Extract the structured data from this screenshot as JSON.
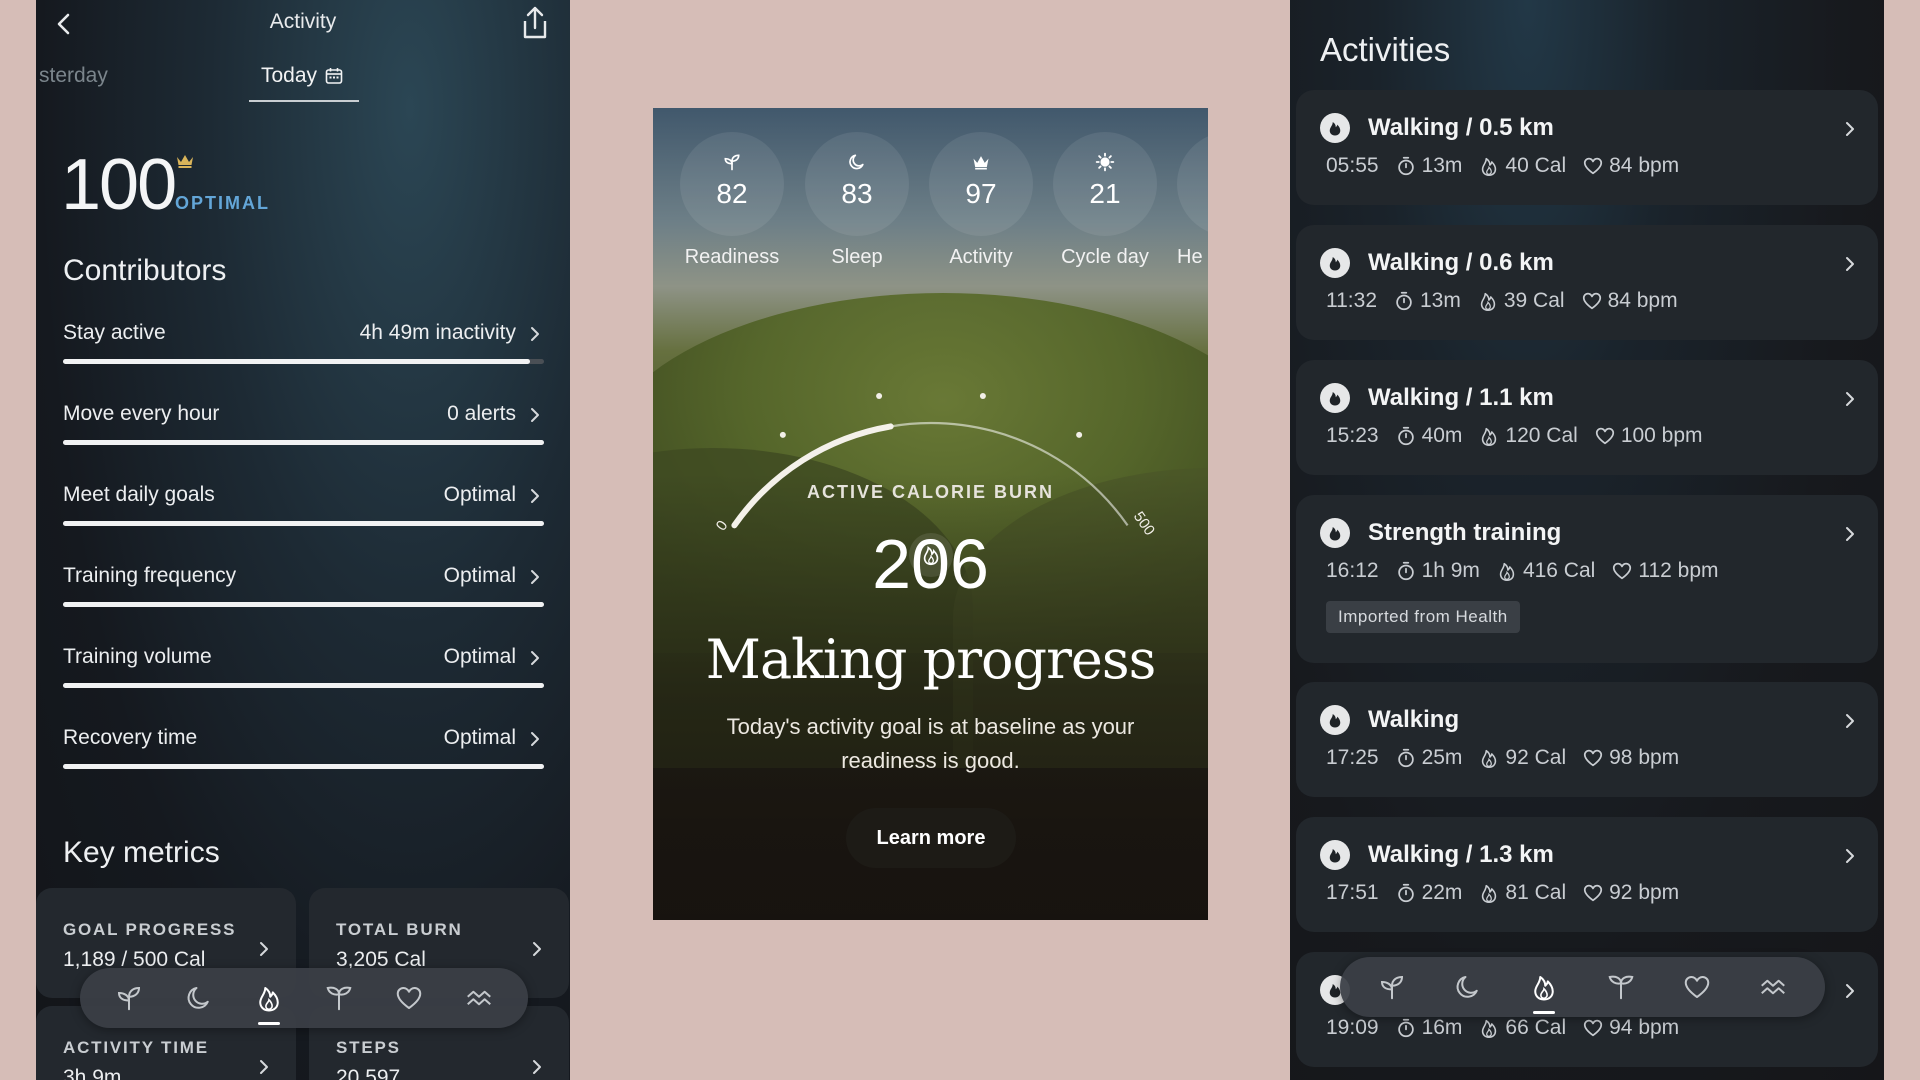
{
  "left": {
    "title": "Activity",
    "day_prev": "sterday",
    "day_current": "Today",
    "score": "100",
    "score_status": "OPTIMAL",
    "contributors_heading": "Contributors",
    "contributors": [
      {
        "label": "Stay active",
        "value": "4h 49m inactivity",
        "level": 0.97
      },
      {
        "label": "Move every hour",
        "value": "0 alerts",
        "level": 1.0
      },
      {
        "label": "Meet daily goals",
        "value": "Optimal",
        "level": 1.0
      },
      {
        "label": "Training frequency",
        "value": "Optimal",
        "level": 1.0
      },
      {
        "label": "Training volume",
        "value": "Optimal",
        "level": 1.0
      },
      {
        "label": "Recovery time",
        "value": "Optimal",
        "level": 1.0
      }
    ],
    "key_metrics_heading": "Key metrics",
    "metrics": [
      {
        "label": "GOAL PROGRESS",
        "value": "1,189 / 500 Cal"
      },
      {
        "label": "TOTAL BURN",
        "value": "3,205 Cal"
      },
      {
        "label": "ACTIVITY TIME",
        "value": "3h 9m"
      },
      {
        "label": "STEPS",
        "value": "20,597"
      }
    ]
  },
  "middle": {
    "scores": [
      {
        "label": "Readiness",
        "value": "82",
        "icon": "sprout-icon"
      },
      {
        "label": "Sleep",
        "value": "83",
        "icon": "moon-icon"
      },
      {
        "label": "Activity",
        "value": "97",
        "icon": "crown-icon"
      },
      {
        "label": "Cycle day",
        "value": "21",
        "icon": "sun-icon"
      },
      {
        "label": "He",
        "value": "",
        "icon": "partial"
      }
    ],
    "gauge": {
      "min_label": "0",
      "max_label": "500",
      "min": 0,
      "max": 500,
      "value": 206
    },
    "metric_label": "ACTIVE CALORIE BURN",
    "metric_value": "206",
    "headline": "Making progress",
    "description": "Today's activity goal is at baseline as your readiness is good.",
    "cta": "Learn more"
  },
  "right": {
    "title": "Activities",
    "activities": [
      {
        "name": "Walking / 0.5 km",
        "time": "05:55",
        "duration": "13m",
        "calories": "40 Cal",
        "heart_rate": "84 bpm"
      },
      {
        "name": "Walking / 0.6 km",
        "time": "11:32",
        "duration": "13m",
        "calories": "39 Cal",
        "heart_rate": "84 bpm"
      },
      {
        "name": "Walking / 1.1 km",
        "time": "15:23",
        "duration": "40m",
        "calories": "120 Cal",
        "heart_rate": "100 bpm"
      },
      {
        "name": "Strength training",
        "time": "16:12",
        "duration": "1h 9m",
        "calories": "416 Cal",
        "heart_rate": "112 bpm",
        "tag": "Imported from Health"
      },
      {
        "name": "Walking",
        "time": "17:25",
        "duration": "25m",
        "calories": "92 Cal",
        "heart_rate": "98 bpm"
      },
      {
        "name": "Walking / 1.3 km",
        "time": "17:51",
        "duration": "22m",
        "calories": "81 Cal",
        "heart_rate": "92 bpm"
      },
      {
        "name": "",
        "time": "19:09",
        "duration": "16m",
        "calories": "66 Cal",
        "heart_rate": "94 bpm"
      }
    ]
  },
  "bottom_nav": {
    "items": [
      "sprout-icon",
      "moon-icon",
      "flame-icon",
      "plant-icon",
      "heart-icon",
      "waves-icon"
    ],
    "active_index": 2
  },
  "colors": {
    "accent_optimal": "#63a6d8",
    "background": "#d6bdb7"
  }
}
